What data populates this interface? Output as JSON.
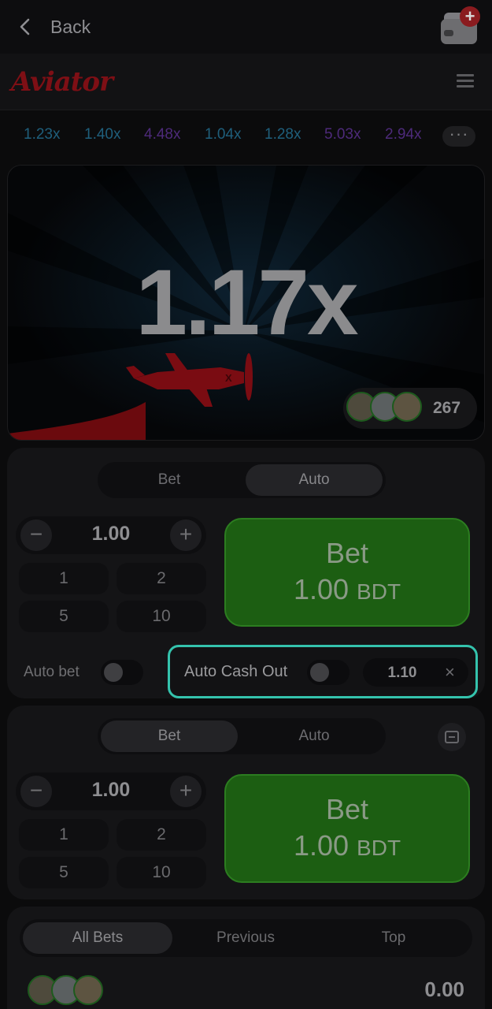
{
  "nav": {
    "back_label": "Back"
  },
  "header": {
    "logo_text": "Aviator"
  },
  "multipliers": [
    {
      "value": "1.23x",
      "color": "blue"
    },
    {
      "value": "1.40x",
      "color": "blue"
    },
    {
      "value": "4.48x",
      "color": "purple"
    },
    {
      "value": "1.04x",
      "color": "blue"
    },
    {
      "value": "1.28x",
      "color": "blue"
    },
    {
      "value": "5.03x",
      "color": "purple"
    },
    {
      "value": "2.94x",
      "color": "purple"
    }
  ],
  "more_label": "···",
  "game": {
    "multiplier": "1.17x",
    "players_count": "267"
  },
  "panel1": {
    "tab_bet": "Bet",
    "tab_auto": "Auto",
    "amount": "1.00",
    "chips": [
      "1",
      "2",
      "5",
      "10"
    ],
    "bet_title": "Bet",
    "bet_amount": "1.00",
    "bet_currency": "BDT",
    "auto_bet_label": "Auto bet",
    "auto_cashout_label": "Auto Cash Out",
    "auto_cashout_value": "1.10",
    "clear_label": "×"
  },
  "panel2": {
    "tab_bet": "Bet",
    "tab_auto": "Auto",
    "amount": "1.00",
    "chips": [
      "1",
      "2",
      "5",
      "10"
    ],
    "bet_title": "Bet",
    "bet_amount": "1.00",
    "bet_currency": "BDT"
  },
  "bets": {
    "tabs": [
      "All Bets",
      "Previous",
      "Top"
    ],
    "total": "0.00"
  },
  "stepper": {
    "minus": "−",
    "plus": "+"
  },
  "colors": {
    "accent_cashout_border": "#34c3ad",
    "bet_button_green": "#1c5e12",
    "logo_red": "#7e0f15"
  }
}
